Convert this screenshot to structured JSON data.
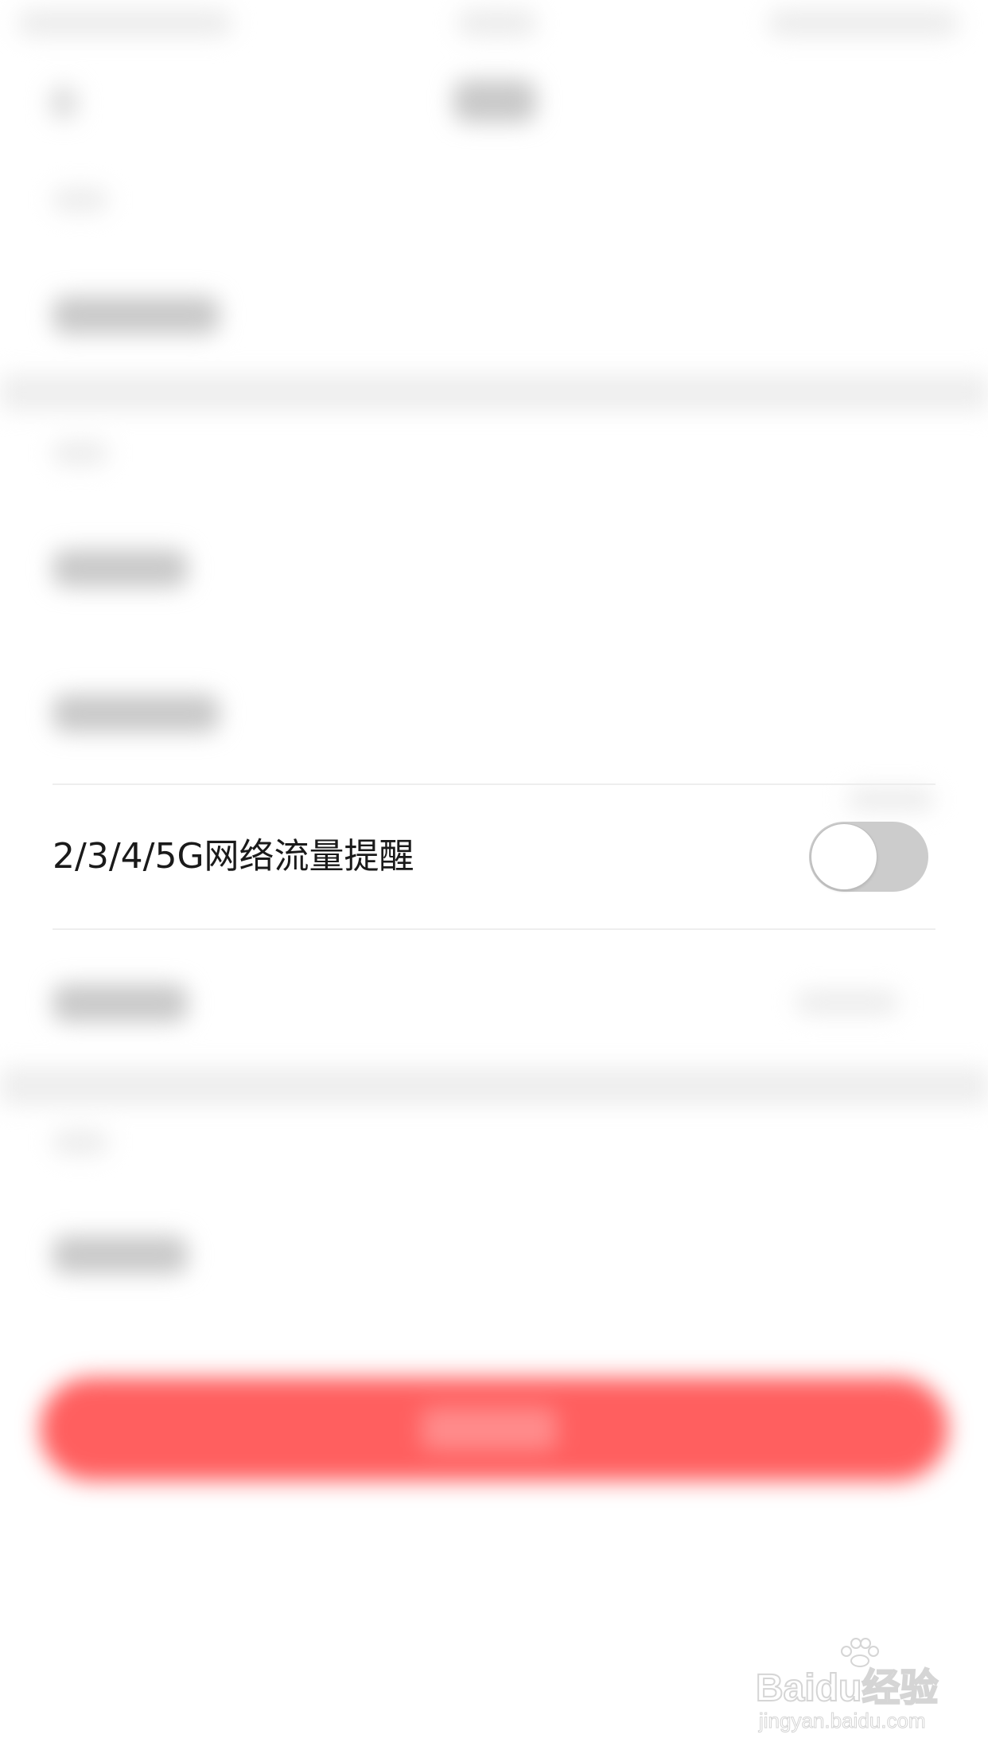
{
  "setting_row": {
    "label": "2/3/4/5G网络流量提醒",
    "toggle_on": false
  },
  "watermark": {
    "brand": "Baidu经验",
    "url": "jingyan.baidu.com"
  },
  "colors": {
    "toggle_off_track": "#cccccc",
    "toggle_knob": "#ffffff",
    "primary_button": "#ff5f5f",
    "divider": "#eeeeee",
    "label_text": "#1a1a1a"
  },
  "icons": {
    "back": "back-arrow-icon",
    "watermark_logo": "baidu-paw-icon"
  }
}
